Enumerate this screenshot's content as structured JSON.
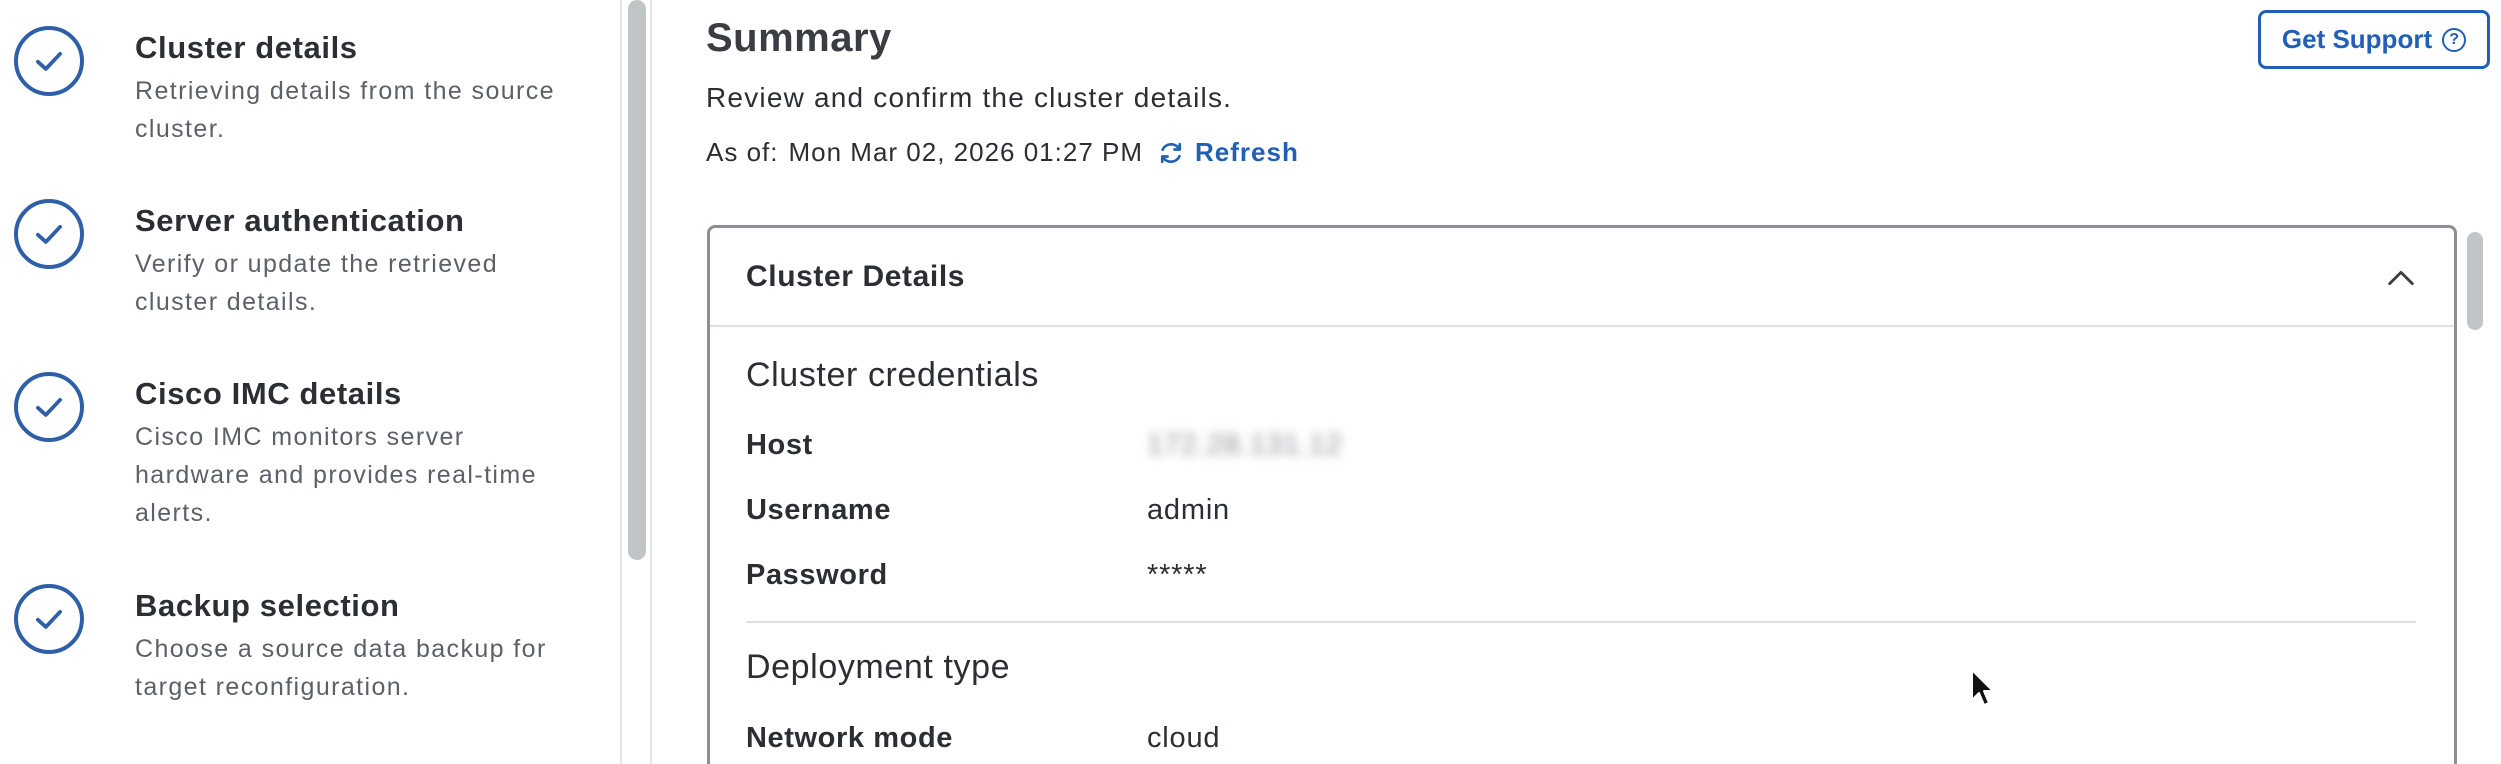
{
  "steps": [
    {
      "title": "Cluster details",
      "description": "Retrieving details from the source cluster.",
      "icon": "check-circle-icon"
    },
    {
      "title": "Server authentication",
      "description": "Verify or update the retrieved cluster details.",
      "icon": "check-circle-icon"
    },
    {
      "title": "Cisco IMC details",
      "description": "Cisco IMC monitors server hardware and provides real-time alerts.",
      "icon": "check-circle-icon"
    },
    {
      "title": "Backup selection",
      "description": "Choose a source data backup for target reconfiguration.",
      "icon": "check-circle-icon"
    }
  ],
  "summary": {
    "title": "Summary",
    "subtitle": "Review and confirm the cluster details.",
    "as_of_label": "As of:",
    "as_of_value": "Mon Mar 02, 2026 01:27 PM",
    "refresh_label": "Refresh"
  },
  "header": {
    "get_support_label": "Get Support",
    "help_icon_glyph": "?"
  },
  "card": {
    "title": "Cluster Details",
    "credentials": {
      "section_title": "Cluster credentials",
      "host_label": "Host",
      "host_value": "172.28.131.12",
      "username_label": "Username",
      "username_value": "admin",
      "password_label": "Password",
      "password_value": "*****"
    },
    "deployment": {
      "section_title": "Deployment type",
      "network_mode_label": "Network mode",
      "network_mode_value": "cloud"
    }
  },
  "colors": {
    "accent": "#2160b6",
    "check": "#2f5fa7",
    "border": "#8c9095"
  }
}
